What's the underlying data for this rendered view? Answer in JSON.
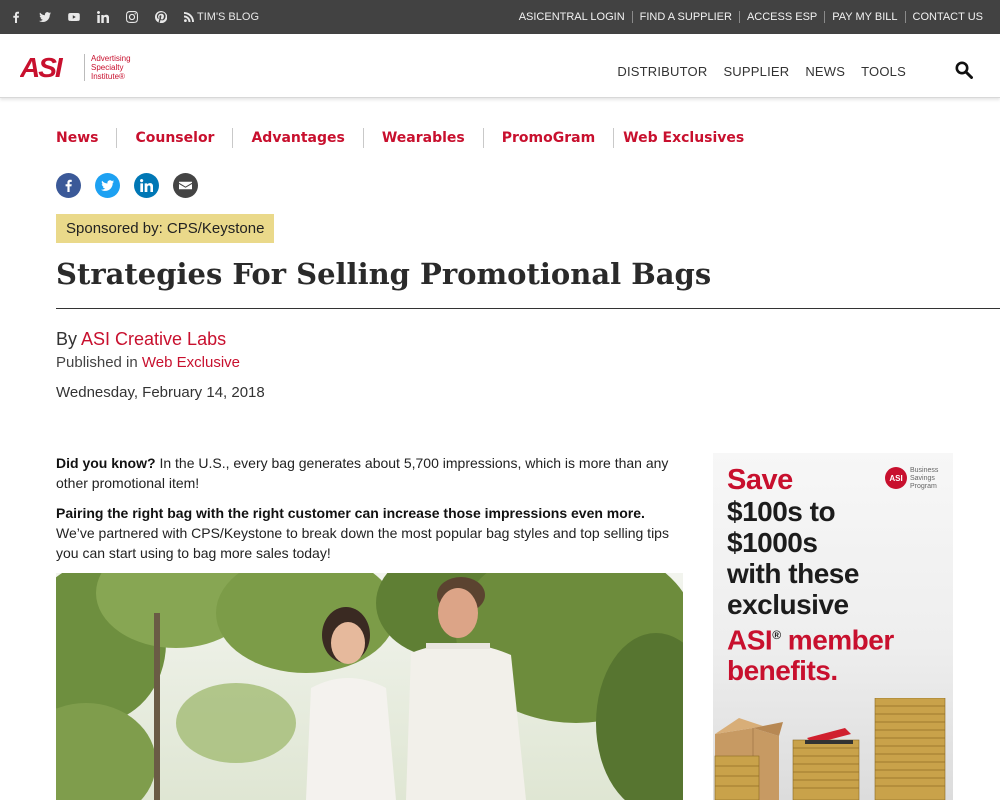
{
  "topbar": {
    "social_icons": [
      "facebook-icon",
      "twitter-icon",
      "youtube-icon",
      "linkedin-icon",
      "instagram-icon",
      "pinterest-icon"
    ],
    "blog_label": "TIM'S BLOG",
    "links": [
      "ASICENTRAL LOGIN",
      "FIND A SUPPLIER",
      "ACCESS ESP",
      "PAY MY BILL",
      "CONTACT US"
    ]
  },
  "header": {
    "logo_text": "ASI",
    "logo_tagline": [
      "Advertising",
      "Specialty",
      "Institute®"
    ],
    "nav": [
      "DISTRIBUTOR",
      "SUPPLIER",
      "NEWS",
      "TOOLS"
    ]
  },
  "section_nav": [
    "News",
    "Counselor",
    "Advantages",
    "Wearables",
    "PromoGram",
    "Web Exclusives"
  ],
  "share_icons": [
    {
      "name": "facebook-share-icon",
      "color": "#3b5998"
    },
    {
      "name": "twitter-share-icon",
      "color": "#1da1f2"
    },
    {
      "name": "linkedin-share-icon",
      "color": "#0077b5"
    },
    {
      "name": "email-share-icon",
      "color": "#444444"
    }
  ],
  "article": {
    "sponsor": "Sponsored by: CPS/Keystone",
    "title": "Strategies For Selling Promotional Bags",
    "by_prefix": "By ",
    "author": "ASI Creative Labs",
    "published_prefix": "Published in ",
    "publication": "Web Exclusive",
    "date": "Wednesday, February 14, 2018",
    "p1_bold": "Did you know?",
    "p1_text": " In the U.S., every bag generates about 5,700 impressions, which is more than any other promotional item!",
    "p2_bold": "Pairing the right bag with the right customer can increase those impressions even more.",
    "p2_text": " We’ve partnered with CPS/Keystone to break down the most popular bag styles and top selling tips you can start using to bag more sales today!"
  },
  "ad": {
    "badge": "ASI",
    "program": "Business Savings Program",
    "line1": "Save",
    "line2": "$100s to",
    "line3": "$1000s",
    "line4": "with these",
    "line5": "exclusive",
    "line6_red": "ASI",
    "line6_reg": "®",
    "line6_rest": " member",
    "line7": "benefits."
  },
  "colors": {
    "brand_red": "#c8102e",
    "topbar": "#424242",
    "sponsor_bg": "#ead98a"
  }
}
